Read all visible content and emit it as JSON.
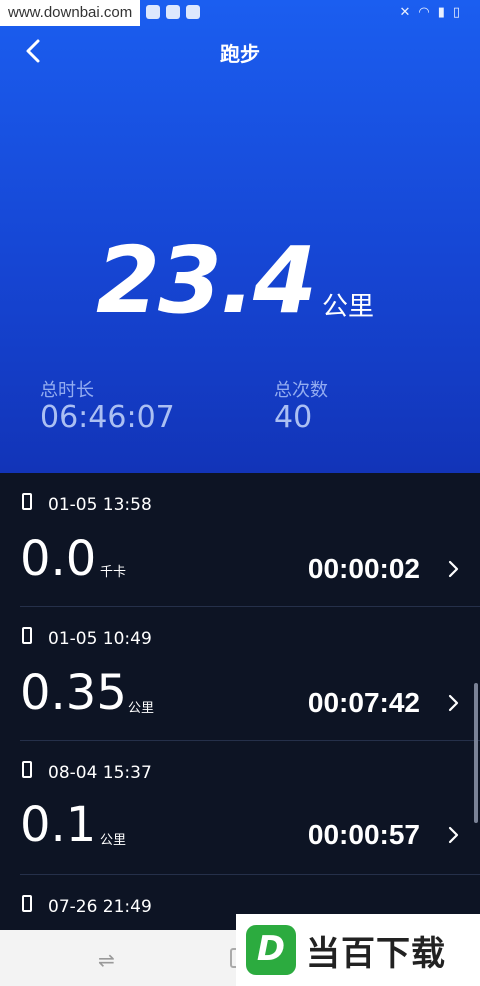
{
  "watermark": "www.downbai.com",
  "header": {
    "title": "跑步"
  },
  "summary": {
    "distance": "23.4",
    "unit": "公里",
    "duration_label": "总时长",
    "duration_value": "06:46:07",
    "count_label": "总次数",
    "count_value": "40"
  },
  "records": [
    {
      "datetime": "01-05 13:58",
      "value": "0.0",
      "unit": "千卡",
      "duration": "00:00:02"
    },
    {
      "datetime": "01-05 10:49",
      "value": "0.35",
      "unit": "公里",
      "duration": "00:07:42"
    },
    {
      "datetime": "08-04 15:37",
      "value": "0.1",
      "unit": "公里",
      "duration": "00:00:57"
    },
    {
      "datetime": "07-26 21:49"
    }
  ],
  "brand": {
    "logo_letter": "D",
    "name": "当百下载"
  },
  "icons": [
    "back-arrow-icon",
    "phone-icon",
    "chevron-right-icon"
  ],
  "colors": {
    "hero_blue": "#1b5ef0",
    "list_bg": "#0d1424",
    "brand_green": "#2cab3f"
  }
}
